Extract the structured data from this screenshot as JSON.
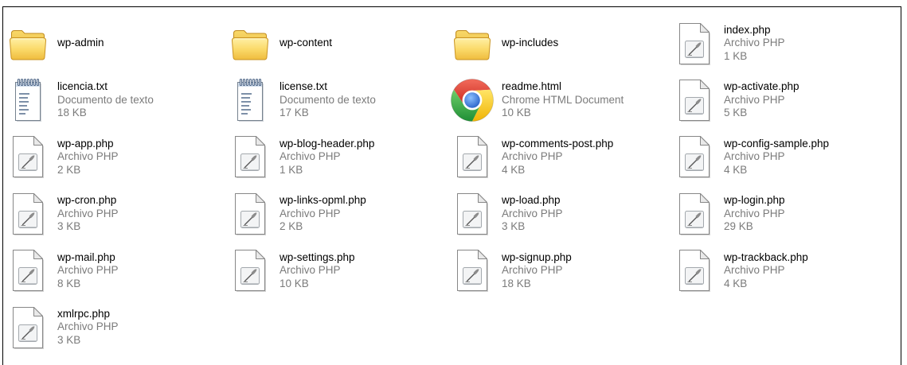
{
  "colors": {
    "background": "#ffffff",
    "frame": "#000000",
    "name_text": "#000000",
    "detail_text": "#7b7b7b"
  },
  "explorer": {
    "files": [
      {
        "name": "wp-admin",
        "icon": "folder-icon"
      },
      {
        "name": "wp-content",
        "icon": "folder-icon"
      },
      {
        "name": "wp-includes",
        "icon": "folder-icon"
      },
      {
        "name": "index.php",
        "type": "Archivo PHP",
        "size": "1 KB",
        "icon": "php-file-icon"
      },
      {
        "name": "licencia.txt",
        "type": "Documento de texto",
        "size": "18 KB",
        "icon": "text-file-icon"
      },
      {
        "name": "license.txt",
        "type": "Documento de texto",
        "size": "17 KB",
        "icon": "text-file-icon"
      },
      {
        "name": "readme.html",
        "type": "Chrome HTML Document",
        "size": "10 KB",
        "icon": "chrome-icon"
      },
      {
        "name": "wp-activate.php",
        "type": "Archivo PHP",
        "size": "5 KB",
        "icon": "php-file-icon"
      },
      {
        "name": "wp-app.php",
        "type": "Archivo PHP",
        "size": "2 KB",
        "icon": "php-file-icon"
      },
      {
        "name": "wp-blog-header.php",
        "type": "Archivo PHP",
        "size": "1 KB",
        "icon": "php-file-icon"
      },
      {
        "name": "wp-comments-post.php",
        "type": "Archivo PHP",
        "size": "4 KB",
        "icon": "php-file-icon"
      },
      {
        "name": "wp-config-sample.php",
        "type": "Archivo PHP",
        "size": "4 KB",
        "icon": "php-file-icon"
      },
      {
        "name": "wp-cron.php",
        "type": "Archivo PHP",
        "size": "3 KB",
        "icon": "php-file-icon"
      },
      {
        "name": "wp-links-opml.php",
        "type": "Archivo PHP",
        "size": "2 KB",
        "icon": "php-file-icon"
      },
      {
        "name": "wp-load.php",
        "type": "Archivo PHP",
        "size": "3 KB",
        "icon": "php-file-icon"
      },
      {
        "name": "wp-login.php",
        "type": "Archivo PHP",
        "size": "29 KB",
        "icon": "php-file-icon"
      },
      {
        "name": "wp-mail.php",
        "type": "Archivo PHP",
        "size": "8 KB",
        "icon": "php-file-icon"
      },
      {
        "name": "wp-settings.php",
        "type": "Archivo PHP",
        "size": "10 KB",
        "icon": "php-file-icon"
      },
      {
        "name": "wp-signup.php",
        "type": "Archivo PHP",
        "size": "18 KB",
        "icon": "php-file-icon"
      },
      {
        "name": "wp-trackback.php",
        "type": "Archivo PHP",
        "size": "4 KB",
        "icon": "php-file-icon"
      },
      {
        "name": "xmlrpc.php",
        "type": "Archivo PHP",
        "size": "3 KB",
        "icon": "php-file-icon"
      }
    ]
  }
}
